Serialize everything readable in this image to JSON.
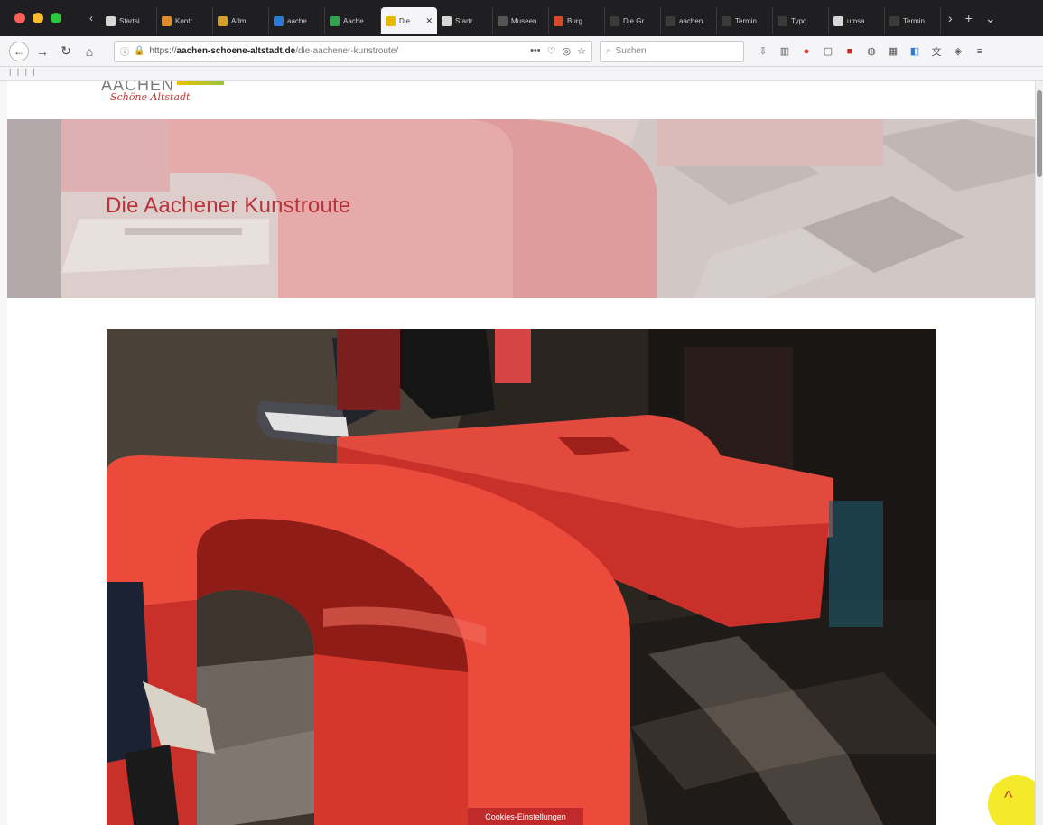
{
  "browser": {
    "tabs": [
      {
        "label": "Startsi",
        "color": "#d6d6d6"
      },
      {
        "label": "Kontr",
        "color": "#e08a2a"
      },
      {
        "label": "Adm",
        "color": "#d6a12a"
      },
      {
        "label": "aache",
        "color": "#2a7ad6"
      },
      {
        "label": "Aache",
        "color": "#2ea44f"
      },
      {
        "label": "Die",
        "color": "#e6b800",
        "active": true
      },
      {
        "label": "Startr",
        "color": "#d6d6d6"
      },
      {
        "label": "Museen",
        "color": "#555555"
      },
      {
        "label": "Burg",
        "color": "#d64a2a"
      },
      {
        "label": "Die Gr",
        "color": "#3a3a3a"
      },
      {
        "label": "aachen",
        "color": "#3a3a3a"
      },
      {
        "label": "Termin",
        "color": "#3a3a3a"
      },
      {
        "label": "Typo",
        "color": "#3a3a3a"
      },
      {
        "label": "umsa",
        "color": "#d6d6d6"
      },
      {
        "label": "Termin",
        "color": "#3a3a3a"
      }
    ],
    "url_scheme": "https://",
    "url_host": "aachen-schoene-altstadt.de",
    "url_path": "/die-aachener-kunstroute/",
    "search_placeholder": "Suchen",
    "more_glyph": "•••",
    "bookmarks_text": "| | | |"
  },
  "site": {
    "logo_main": "AACHEN",
    "logo_sub": "Schöne Altstadt",
    "hero_title": "Die Aachener Kunstroute",
    "cookie_button": "Cookies-Einstellungen",
    "scroll_top_glyph": "^"
  }
}
